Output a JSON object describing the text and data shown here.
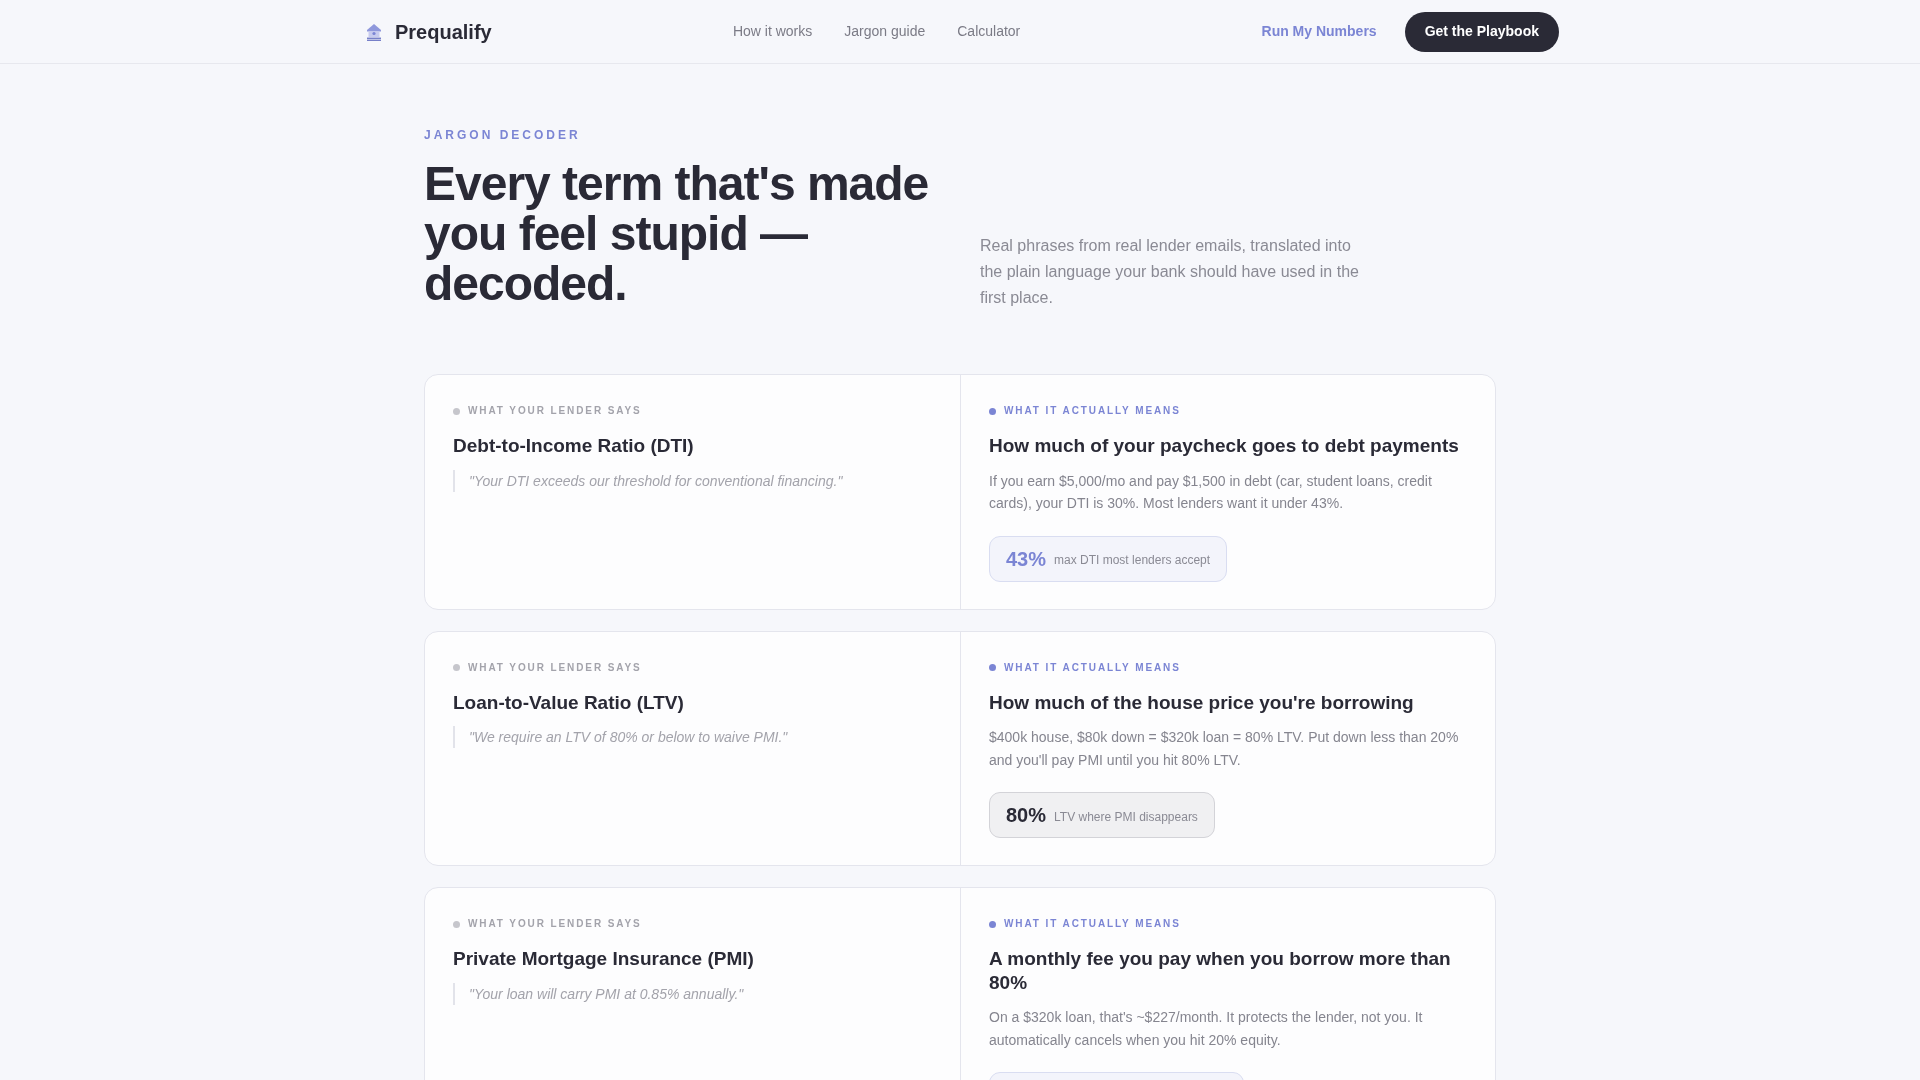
{
  "navbar": {
    "brand": "Prequalify",
    "links": [
      {
        "label": "How it works"
      },
      {
        "label": "Jargon guide"
      },
      {
        "label": "Calculator"
      }
    ],
    "secondary_action": "Run My Numbers",
    "primary_action": "Get the Playbook"
  },
  "hero": {
    "eyebrow": "JARGON DECODER",
    "title": "Every term that's made you feel stupid — decoded.",
    "description": "Real phrases from real lender emails, translated into the plain language your bank should have used in the first place."
  },
  "terms": [
    {
      "lender_label": "WHAT YOUR LENDER SAYS",
      "term": "Debt-to-Income Ratio (DTI)",
      "quote": "\"Your DTI exceeds our threshold for conventional financing.\"",
      "meaning_label": "WHAT IT ACTUALLY MEANS",
      "meaning_title": "How much of your paycheck goes to debt payments",
      "explanation": "If you earn $5,000/mo and pay $1,500 in debt (car, student loans, credit cards), your DTI is 30%. Most lenders want it under 43%.",
      "stat": {
        "highlighted": true,
        "value": "43%",
        "label": "max DTI most lenders accept"
      }
    },
    {
      "lender_label": "WHAT YOUR LENDER SAYS",
      "term": "Loan-to-Value Ratio (LTV)",
      "quote": "\"We require an LTV of 80% or below to waive PMI.\"",
      "meaning_label": "WHAT IT ACTUALLY MEANS",
      "meaning_title": "How much of the house price you're borrowing",
      "explanation": "$400k house, $80k down = $320k loan = 80% LTV. Put down less than 20% and you'll pay PMI until you hit 80% LTV.",
      "stat": {
        "highlighted": false,
        "value": "80%",
        "label": "LTV where PMI disappears"
      }
    },
    {
      "lender_label": "WHAT YOUR LENDER SAYS",
      "term": "Private Mortgage Insurance (PMI)",
      "quote": "\"Your loan will carry PMI at 0.85% annually.\"",
      "meaning_label": "WHAT IT ACTUALLY MEANS",
      "meaning_title": "A monthly fee you pay when you borrow more than 80%",
      "explanation": "On a $320k loan, that's ~$227/month. It protects the lender, not you. It automatically cancels when you hit 20% equity.",
      "stat": {
        "highlighted": true
      }
    }
  ]
}
